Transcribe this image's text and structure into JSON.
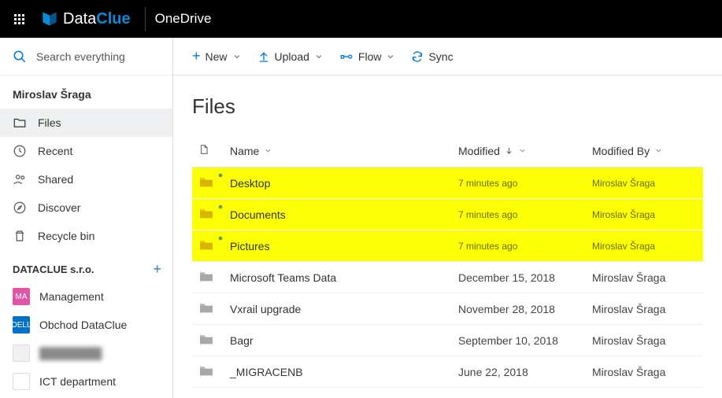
{
  "header": {
    "brand_plain": "Data",
    "brand_bold": "Clue",
    "app_title": "OneDrive"
  },
  "search": {
    "placeholder": "Search everything"
  },
  "user": {
    "name": "Miroslav Šraga"
  },
  "nav": {
    "files": "Files",
    "recent": "Recent",
    "shared": "Shared",
    "discover": "Discover",
    "recycle": "Recycle bin"
  },
  "section": {
    "title": "DATACLUE s.r.o."
  },
  "favorites": [
    {
      "label": "Management",
      "badge_bg": "#e055a5",
      "badge_txt": "MA"
    },
    {
      "label": "Obchod DataClue",
      "badge_bg": "#0071c5",
      "badge_txt": "DELL"
    },
    {
      "label": "",
      "badge_bg": "#f0f0f0",
      "badge_txt": ""
    },
    {
      "label": "ICT department",
      "badge_bg": "#ffffff",
      "badge_txt": ""
    }
  ],
  "toolbar": {
    "new": "New",
    "upload": "Upload",
    "flow": "Flow",
    "sync": "Sync"
  },
  "page": {
    "heading": "Files"
  },
  "columns": {
    "name": "Name",
    "modified": "Modified",
    "modified_by": "Modified By"
  },
  "rows": [
    {
      "name": "Desktop",
      "modified": "7 minutes ago",
      "by": "Miroslav Šraga",
      "hl": true,
      "yellow": true
    },
    {
      "name": "Documents",
      "modified": "7 minutes ago",
      "by": "Miroslav Šraga",
      "hl": true,
      "yellow": true
    },
    {
      "name": "Pictures",
      "modified": "7 minutes ago",
      "by": "Miroslav Šraga",
      "hl": true,
      "yellow": true
    },
    {
      "name": "Microsoft Teams Data",
      "modified": "December 15, 2018",
      "by": "Miroslav Šraga",
      "hl": false,
      "yellow": false
    },
    {
      "name": "Vxrail upgrade",
      "modified": "November 28, 2018",
      "by": "Miroslav Šraga",
      "hl": false,
      "yellow": false
    },
    {
      "name": "Bagr",
      "modified": "September 10, 2018",
      "by": "Miroslav Šraga",
      "hl": false,
      "yellow": false
    },
    {
      "name": "_MIGRACENB",
      "modified": "June 22, 2018",
      "by": "Miroslav Šraga",
      "hl": false,
      "yellow": false
    }
  ]
}
